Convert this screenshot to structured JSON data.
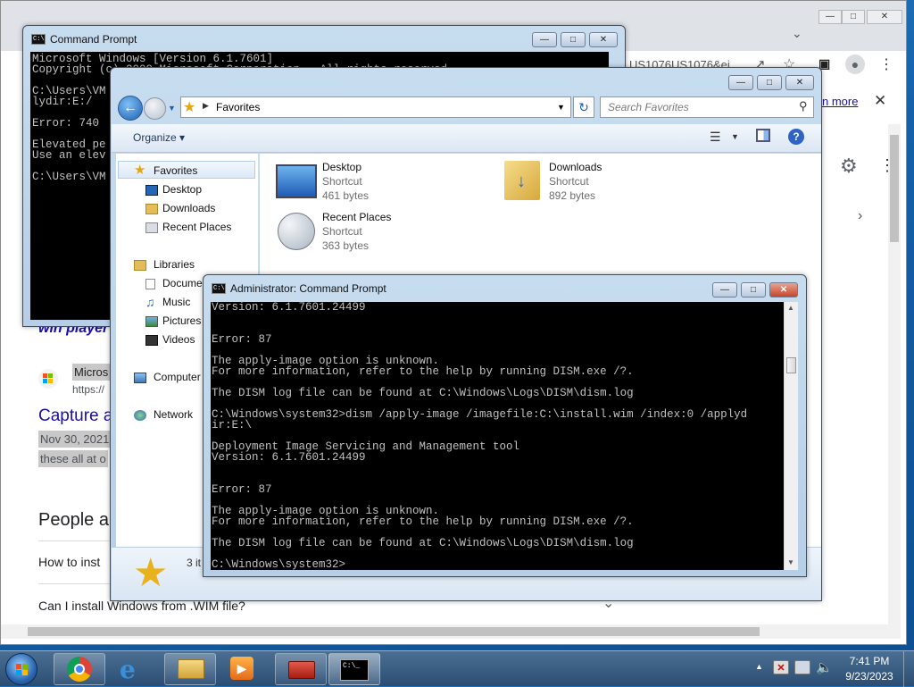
{
  "browser": {
    "omnibox_fragment": "US1076US1076&ei",
    "learn_more": "n more",
    "result_title_fragment": "win player",
    "result_source_fragment": "Micros",
    "result_url_fragment": "https://",
    "capture_heading": "Capture a",
    "date_snippet": "Nov 30, 2021",
    "snippet_tail": "these all at o",
    "people_heading": "People a",
    "faq_1": "How to inst",
    "faq_2": "Can I install Windows from .WIM file?"
  },
  "cmd_back": {
    "title": "Command Prompt",
    "lines": [
      "Microsoft Windows [Version 6.1.7601]",
      "Copyright (c) 2009 Microsoft Corporation.  All rights reserved.",
      "",
      "C:\\Users\\VM",
      "lydir:E:/",
      "",
      "Error: 740",
      "",
      "Elevated pe",
      "Use an elev",
      "",
      "C:\\Users\\VM"
    ]
  },
  "explorer": {
    "address": "Favorites",
    "search_placeholder": "Search Favorites",
    "organize": "Organize",
    "nav": {
      "favorites": "Favorites",
      "desktop": "Desktop",
      "downloads": "Downloads",
      "recent": "Recent Places",
      "libraries": "Libraries",
      "documents": "Docume",
      "music": "Music",
      "pictures": "Pictures",
      "videos": "Videos",
      "computer": "Computer",
      "network": "Network"
    },
    "items": [
      {
        "name": "Desktop",
        "type": "Shortcut",
        "size": "461 bytes"
      },
      {
        "name": "Downloads",
        "type": "Shortcut",
        "size": "892 bytes"
      },
      {
        "name": "Recent Places",
        "type": "Shortcut",
        "size": "363 bytes"
      }
    ],
    "status_count": "3 it"
  },
  "cmd_admin": {
    "title": "Administrator: Command Prompt",
    "lines": [
      "Version: 6.1.7601.24499",
      "",
      "",
      "Error: 87",
      "",
      "The apply-image option is unknown.",
      "For more information, refer to the help by running DISM.exe /?.",
      "",
      "The DISM log file can be found at C:\\Windows\\Logs\\DISM\\dism.log",
      "",
      "C:\\Windows\\system32>dism /apply-image /imagefile:C:\\install.wim /index:0 /applyd",
      "ir:E:\\",
      "",
      "Deployment Image Servicing and Management tool",
      "Version: 6.1.7601.24499",
      "",
      "",
      "Error: 87",
      "",
      "The apply-image option is unknown.",
      "For more information, refer to the help by running DISM.exe /?.",
      "",
      "The DISM log file can be found at C:\\Windows\\Logs\\DISM\\dism.log",
      "",
      "C:\\Windows\\system32>"
    ]
  },
  "taskbar": {
    "time": "7:41 PM",
    "date": "9/23/2023"
  },
  "colors": {
    "console_bg": "#000000",
    "console_fg": "#c0c0c0",
    "link_blue": "#1a0dab"
  }
}
